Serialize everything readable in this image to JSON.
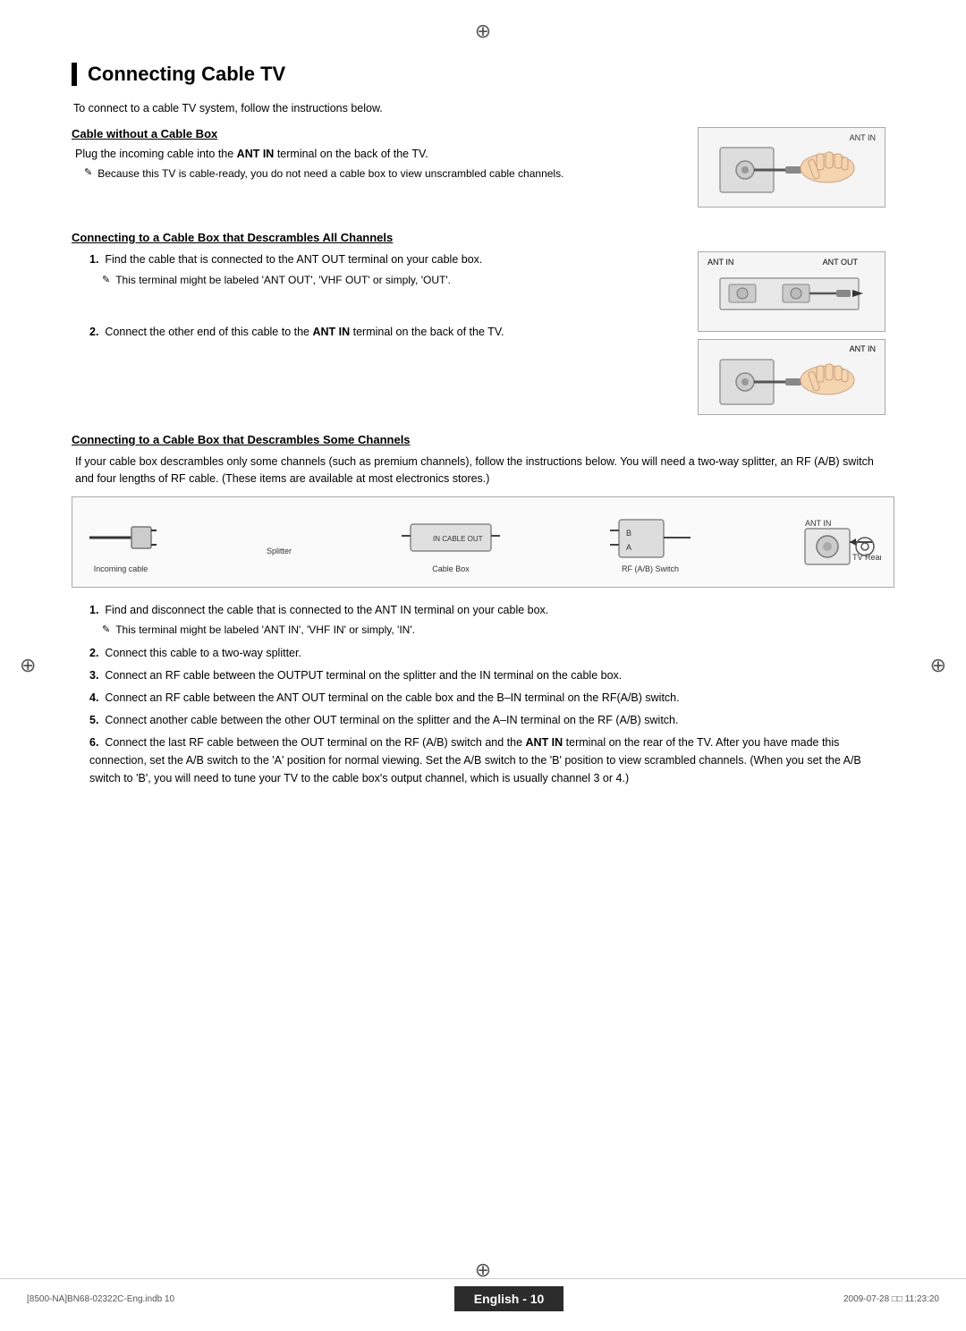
{
  "page": {
    "title": "Connecting Cable TV",
    "intro": "To connect to a cable TV system, follow the instructions below.",
    "section1": {
      "heading": "Cable without a Cable Box",
      "body": "Plug the incoming cable into the ANT IN terminal on the back of the TV.",
      "body_bold_part": "ANT IN",
      "note": "Because this TV is cable-ready, you do not need a cable box to view unscrambled cable channels."
    },
    "section2": {
      "heading": "Connecting to a Cable Box that Descrambles All Channels",
      "step1_body": "Find the cable that is connected to the ANT OUT terminal on your cable box.",
      "step1_note": "This terminal might be labeled 'ANT OUT', 'VHF OUT' or simply, 'OUT'.",
      "step2_body": "Connect the other end of this cable to the ANT IN terminal on the back of the TV.",
      "step2_bold": "ANT IN"
    },
    "section3": {
      "heading": "Connecting to a Cable Box that Descrambles Some Channels",
      "intro": "If your cable box descrambles only some channels (such as premium channels), follow the instructions below. You will need a two-way splitter, an RF (A/B) switch and four lengths of RF cable. (These items are available at most electronics stores.)",
      "step1_body": "Find and disconnect the cable that is connected to the ANT IN terminal on your cable box.",
      "step1_note": "This terminal might be labeled 'ANT IN', 'VHF IN' or simply, 'IN'.",
      "step2_body": "Connect this cable to a two-way splitter.",
      "step3_body": "Connect an RF cable between the OUTPUT terminal on the splitter and the IN terminal on the cable box.",
      "step4_body": "Connect an RF cable between the ANT OUT terminal on the cable box and the B–IN terminal on the RF(A/B) switch.",
      "step5_body": "Connect another cable between the other OUT terminal on the splitter and the A–IN terminal on the RF (A/B) switch.",
      "step6_body": "Connect the last RF cable between the OUT terminal on the RF (A/B) switch and the ANT IN terminal on the rear of the TV. After you have made this connection, set the A/B switch to the 'A' position for normal viewing. Set the A/B switch to the 'B' position to view scrambled channels. (When you set the A/B switch to 'B', you will need to tune your TV to the cable box's output channel, which is usually channel 3 or 4.)",
      "step6_bold": "ANT IN",
      "diagram_labels": {
        "incoming_cable": "Incoming cable",
        "splitter": "Splitter",
        "cable_box": "Cable Box",
        "rf_switch": "RF (A/B) Switch",
        "ant_in": "ANT IN",
        "tv_rear": "TV Rear",
        "in": "IN",
        "cable": "CABLE",
        "out": "OUT"
      }
    },
    "footer": {
      "left": "[8500-NA]BN68-02322C-Eng.indb  10",
      "center": "English - 10",
      "right": "2009-07-28   □□ 11:23:20"
    }
  }
}
